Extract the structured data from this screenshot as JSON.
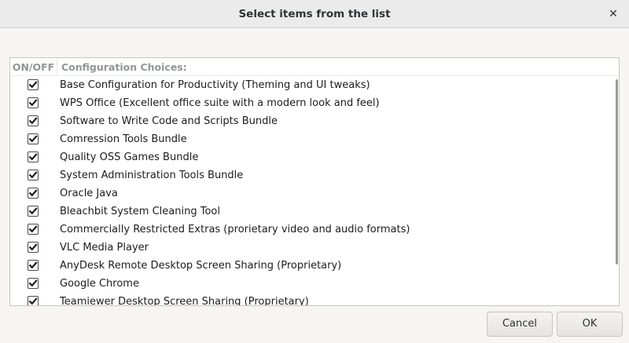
{
  "window": {
    "title": "Select items from the list"
  },
  "list": {
    "columns": {
      "onoff": "ON/OFF",
      "choices": "Configuration Choices:"
    },
    "items": [
      {
        "label": "Base Configuration for Productivity (Theming and UI tweaks)",
        "checked": true
      },
      {
        "label": "WPS Office (Excellent office suite with a modern look and feel)",
        "checked": true
      },
      {
        "label": "Software to Write Code and Scripts Bundle",
        "checked": true
      },
      {
        "label": "Comression Tools Bundle",
        "checked": true
      },
      {
        "label": "Quality OSS Games Bundle",
        "checked": true
      },
      {
        "label": "System Administration Tools Bundle",
        "checked": true
      },
      {
        "label": "Oracle Java",
        "checked": true
      },
      {
        "label": "Bleachbit System Cleaning Tool",
        "checked": true
      },
      {
        "label": "Commercially Restricted Extras (prorietary video and audio formats)",
        "checked": true
      },
      {
        "label": "VLC Media Player",
        "checked": true
      },
      {
        "label": "AnyDesk Remote Desktop Screen Sharing (Proprietary)",
        "checked": true
      },
      {
        "label": "Google Chrome",
        "checked": true
      },
      {
        "label": "Teamiewer Desktop Screen Sharing (Proprietary)",
        "checked": true
      }
    ]
  },
  "buttons": {
    "cancel": "Cancel",
    "ok": "OK"
  },
  "icons": {
    "close": "close-icon",
    "check": "checkmark-icon"
  }
}
